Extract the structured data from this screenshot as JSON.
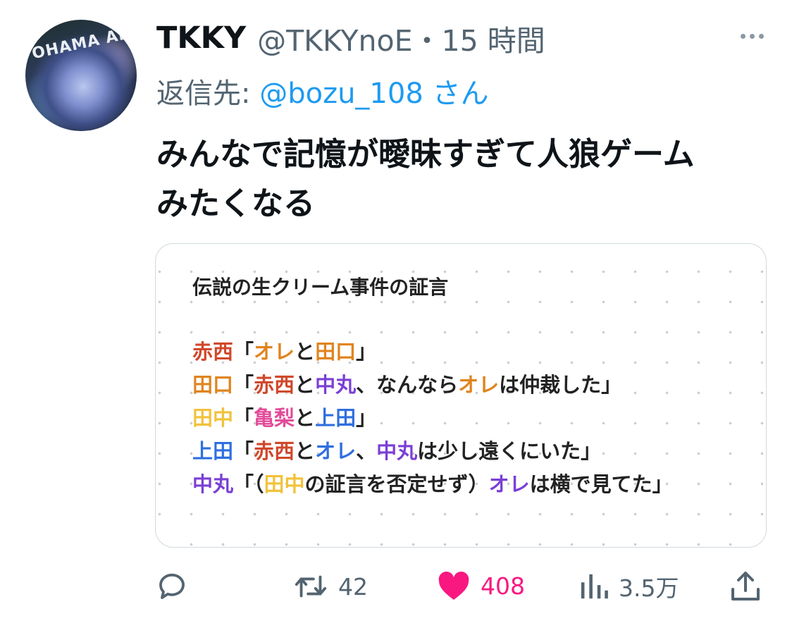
{
  "tweet": {
    "avatar_text": "OHAMA ARE",
    "display_name": "TKKY",
    "handle_time": "@TKKYnoE・15 時間",
    "reply_prefix": "返信先: ",
    "reply_to": "@bozu_108 さん",
    "text_line1": "みんなで記憶が曖昧すぎて人狼ゲーム",
    "text_line2": "みたくなる"
  },
  "card": {
    "title": "伝説の生クリーム事件の証言",
    "lines": [
      [
        {
          "t": "赤西",
          "c": "#d0482b"
        },
        {
          "t": "「",
          "c": "#222222"
        },
        {
          "t": "オレ",
          "c": "#e0841f"
        },
        {
          "t": "と",
          "c": "#222222"
        },
        {
          "t": "田口",
          "c": "#e0841f"
        },
        {
          "t": "」",
          "c": "#222222"
        }
      ],
      [
        {
          "t": "田口",
          "c": "#e0841f"
        },
        {
          "t": "「",
          "c": "#222222"
        },
        {
          "t": "赤西",
          "c": "#d0482b"
        },
        {
          "t": "と",
          "c": "#222222"
        },
        {
          "t": "中丸",
          "c": "#7a3fd6"
        },
        {
          "t": "、なんなら",
          "c": "#222222"
        },
        {
          "t": "オレ",
          "c": "#e0841f"
        },
        {
          "t": "は仲裁した」",
          "c": "#222222"
        }
      ],
      [
        {
          "t": "田中",
          "c": "#f2c23b"
        },
        {
          "t": "「",
          "c": "#222222"
        },
        {
          "t": "亀梨",
          "c": "#e34b9a"
        },
        {
          "t": "と",
          "c": "#222222"
        },
        {
          "t": "上田",
          "c": "#2e6fe0"
        },
        {
          "t": "」",
          "c": "#222222"
        }
      ],
      [
        {
          "t": "上田",
          "c": "#2e6fe0"
        },
        {
          "t": "「",
          "c": "#222222"
        },
        {
          "t": "赤西",
          "c": "#d0482b"
        },
        {
          "t": "と",
          "c": "#222222"
        },
        {
          "t": "オレ",
          "c": "#2e6fe0"
        },
        {
          "t": "、",
          "c": "#222222"
        },
        {
          "t": "中丸",
          "c": "#7a3fd6"
        },
        {
          "t": "は少し遠くにいた」",
          "c": "#222222"
        }
      ],
      [
        {
          "t": "中丸",
          "c": "#7a3fd6"
        },
        {
          "t": "「（",
          "c": "#222222"
        },
        {
          "t": "田中",
          "c": "#f2c23b"
        },
        {
          "t": "の証言を否定せず）",
          "c": "#222222"
        },
        {
          "t": "オレ",
          "c": "#7a3fd6"
        },
        {
          "t": "は横で見てた」",
          "c": "#222222"
        }
      ]
    ]
  },
  "actions": {
    "retweets": "42",
    "likes": "408",
    "views": "3.5万"
  },
  "colors": {
    "like": "#f91880",
    "mention": "#1d9bf0",
    "secondary_text": "#536471"
  },
  "icons": [
    "reply-icon",
    "retweet-icon",
    "heart-icon",
    "views-icon",
    "share-icon",
    "more-icon"
  ]
}
